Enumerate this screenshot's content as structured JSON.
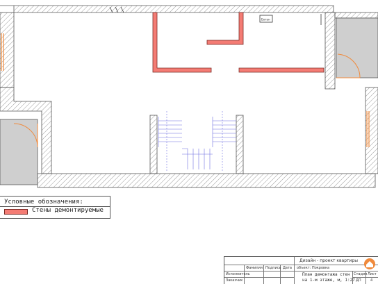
{
  "room_labels": {
    "bath": "Ботан"
  },
  "legend": {
    "heading": "Условные обозначения:",
    "item_label": "Стены демонтируемые",
    "item_color": "#f47c74"
  },
  "title_block": {
    "project": "Дизайн - проект квартиры",
    "client": "объект: Покровка",
    "col_surname": "Фамилия",
    "col_signature": "Подпись",
    "col_date": "Дата",
    "role_executor": "Исполнитель",
    "role_customer": "Заказчик",
    "sheet_title_1": "План демонтажа стен",
    "sheet_title_2": "на 1-м этаже, м, 1:27",
    "col_stage": "Стадия",
    "col_sheet": "Лист",
    "stage": "ДП",
    "sheet": "4"
  },
  "colors": {
    "demolish_fill": "#f47c74",
    "demolish_stroke": "#7a2a25",
    "door_arc": "#f08a3c",
    "stair_lines": "#6f6fe0",
    "wall_hatch": "#999999",
    "room_gray": "#cfcfcf"
  }
}
